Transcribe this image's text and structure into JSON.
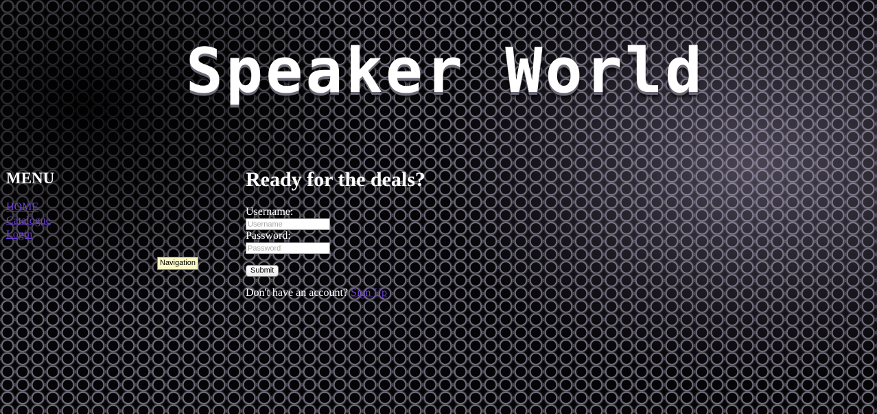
{
  "header": {
    "title": "Speaker World"
  },
  "menu": {
    "heading": "MENU",
    "items": [
      {
        "label": "HOME"
      },
      {
        "label": "Catalogue"
      },
      {
        "label": "Login"
      }
    ],
    "tooltip": "Navigation"
  },
  "login": {
    "heading": "Ready for the deals?",
    "username_label": "Username:",
    "username_placeholder": "Username",
    "username_value": "",
    "password_label": "Password:",
    "password_placeholder": "Password",
    "password_value": "",
    "submit_label": "Submit",
    "signup_prompt": "Don't have an account?",
    "signup_link": "Sign Up"
  },
  "colors": {
    "link": "#6f3fd8",
    "text": "#ffffff",
    "tooltip_bg": "#fbf8c6"
  }
}
